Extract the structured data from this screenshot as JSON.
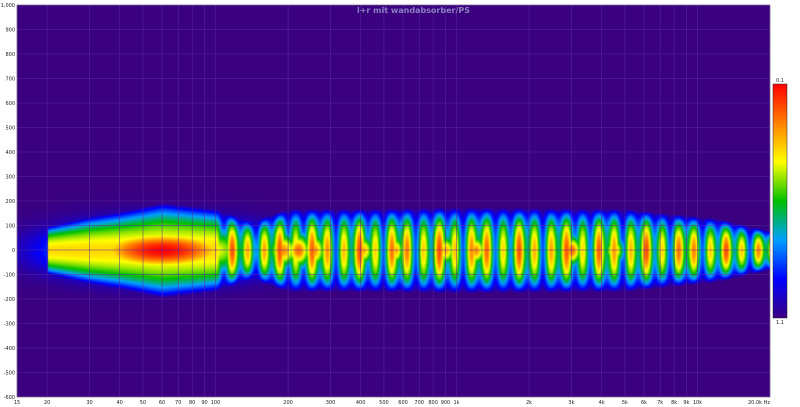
{
  "chart_data": {
    "type": "heatmap",
    "title": "l+r mit wandabsorber/PS",
    "x_scale": "log",
    "xlim": [
      15,
      20000
    ],
    "ylim": [
      -600,
      1000
    ],
    "grid": true,
    "x_tick_labels": [
      "15",
      "20",
      "30",
      "40",
      "50",
      "60",
      "70",
      "80",
      "90",
      "100",
      "200",
      "300",
      "400",
      "500",
      "600",
      "700",
      "800",
      "900",
      "1k",
      "2k",
      "3k",
      "4k",
      "5k",
      "6k",
      "7k",
      "8k",
      "9k",
      "10k",
      "20.0k Hz"
    ],
    "x_tick_values": [
      15,
      20,
      30,
      40,
      50,
      60,
      70,
      80,
      90,
      100,
      200,
      300,
      400,
      500,
      600,
      700,
      800,
      900,
      1000,
      2000,
      3000,
      4000,
      5000,
      6000,
      7000,
      8000,
      9000,
      10000,
      20000
    ],
    "y_tick_labels": [
      "-600",
      "-500",
      "-400",
      "-300",
      "-200",
      "-100",
      "0",
      "100",
      "200",
      "300",
      "400",
      "500",
      "600",
      "700",
      "800",
      "900",
      "1,000"
    ],
    "y_tick_values": [
      -600,
      -500,
      -400,
      -300,
      -200,
      -100,
      0,
      100,
      200,
      300,
      400,
      500,
      600,
      700,
      800,
      900,
      1000
    ],
    "colorbar": {
      "max_label": "0.1",
      "min_label": "1.1",
      "colors": [
        "#ff0000",
        "#ff8000",
        "#ffff00",
        "#00c000",
        "#00a0ff",
        "#0000ff",
        "#3a0080"
      ]
    },
    "background_color": "#3a0080",
    "band": {
      "x_start": 20,
      "x_end": 20000,
      "center_y": 0,
      "envelope_halfwidth": [
        {
          "x": 20,
          "v": 100
        },
        {
          "x": 30,
          "v": 140
        },
        {
          "x": 40,
          "v": 160
        },
        {
          "x": 60,
          "v": 195
        },
        {
          "x": 100,
          "v": 170
        },
        {
          "x": 140,
          "v": 120
        },
        {
          "x": 200,
          "v": 170
        },
        {
          "x": 400,
          "v": 170
        },
        {
          "x": 1000,
          "v": 175
        },
        {
          "x": 5000,
          "v": 170
        },
        {
          "x": 12000,
          "v": 130
        },
        {
          "x": 20000,
          "v": 80
        }
      ],
      "hotspots": [
        {
          "x": 60,
          "y": 0,
          "intensity": 1.0,
          "wx": 0.35,
          "wy": 90
        },
        {
          "x": 190,
          "y": 0,
          "intensity": 0.8,
          "wx": 0.06,
          "wy": 70
        },
        {
          "x": 220,
          "y": 0,
          "intensity": 0.85,
          "wx": 0.05,
          "wy": 70
        },
        {
          "x": 255,
          "y": 0,
          "intensity": 0.8,
          "wx": 0.05,
          "wy": 70
        },
        {
          "x": 410,
          "y": 0,
          "intensity": 0.75,
          "wx": 0.04,
          "wy": 60
        },
        {
          "x": 560,
          "y": 0,
          "intensity": 0.75,
          "wx": 0.03,
          "wy": 60
        },
        {
          "x": 900,
          "y": 0,
          "intensity": 0.75,
          "wx": 0.04,
          "wy": 60
        },
        {
          "x": 1200,
          "y": 0,
          "intensity": 0.8,
          "wx": 0.04,
          "wy": 60
        },
        {
          "x": 3000,
          "y": 0,
          "intensity": 0.85,
          "wx": 0.04,
          "wy": 60
        },
        {
          "x": 4500,
          "y": 0,
          "intensity": 0.75,
          "wx": 0.04,
          "wy": 55
        }
      ]
    }
  }
}
